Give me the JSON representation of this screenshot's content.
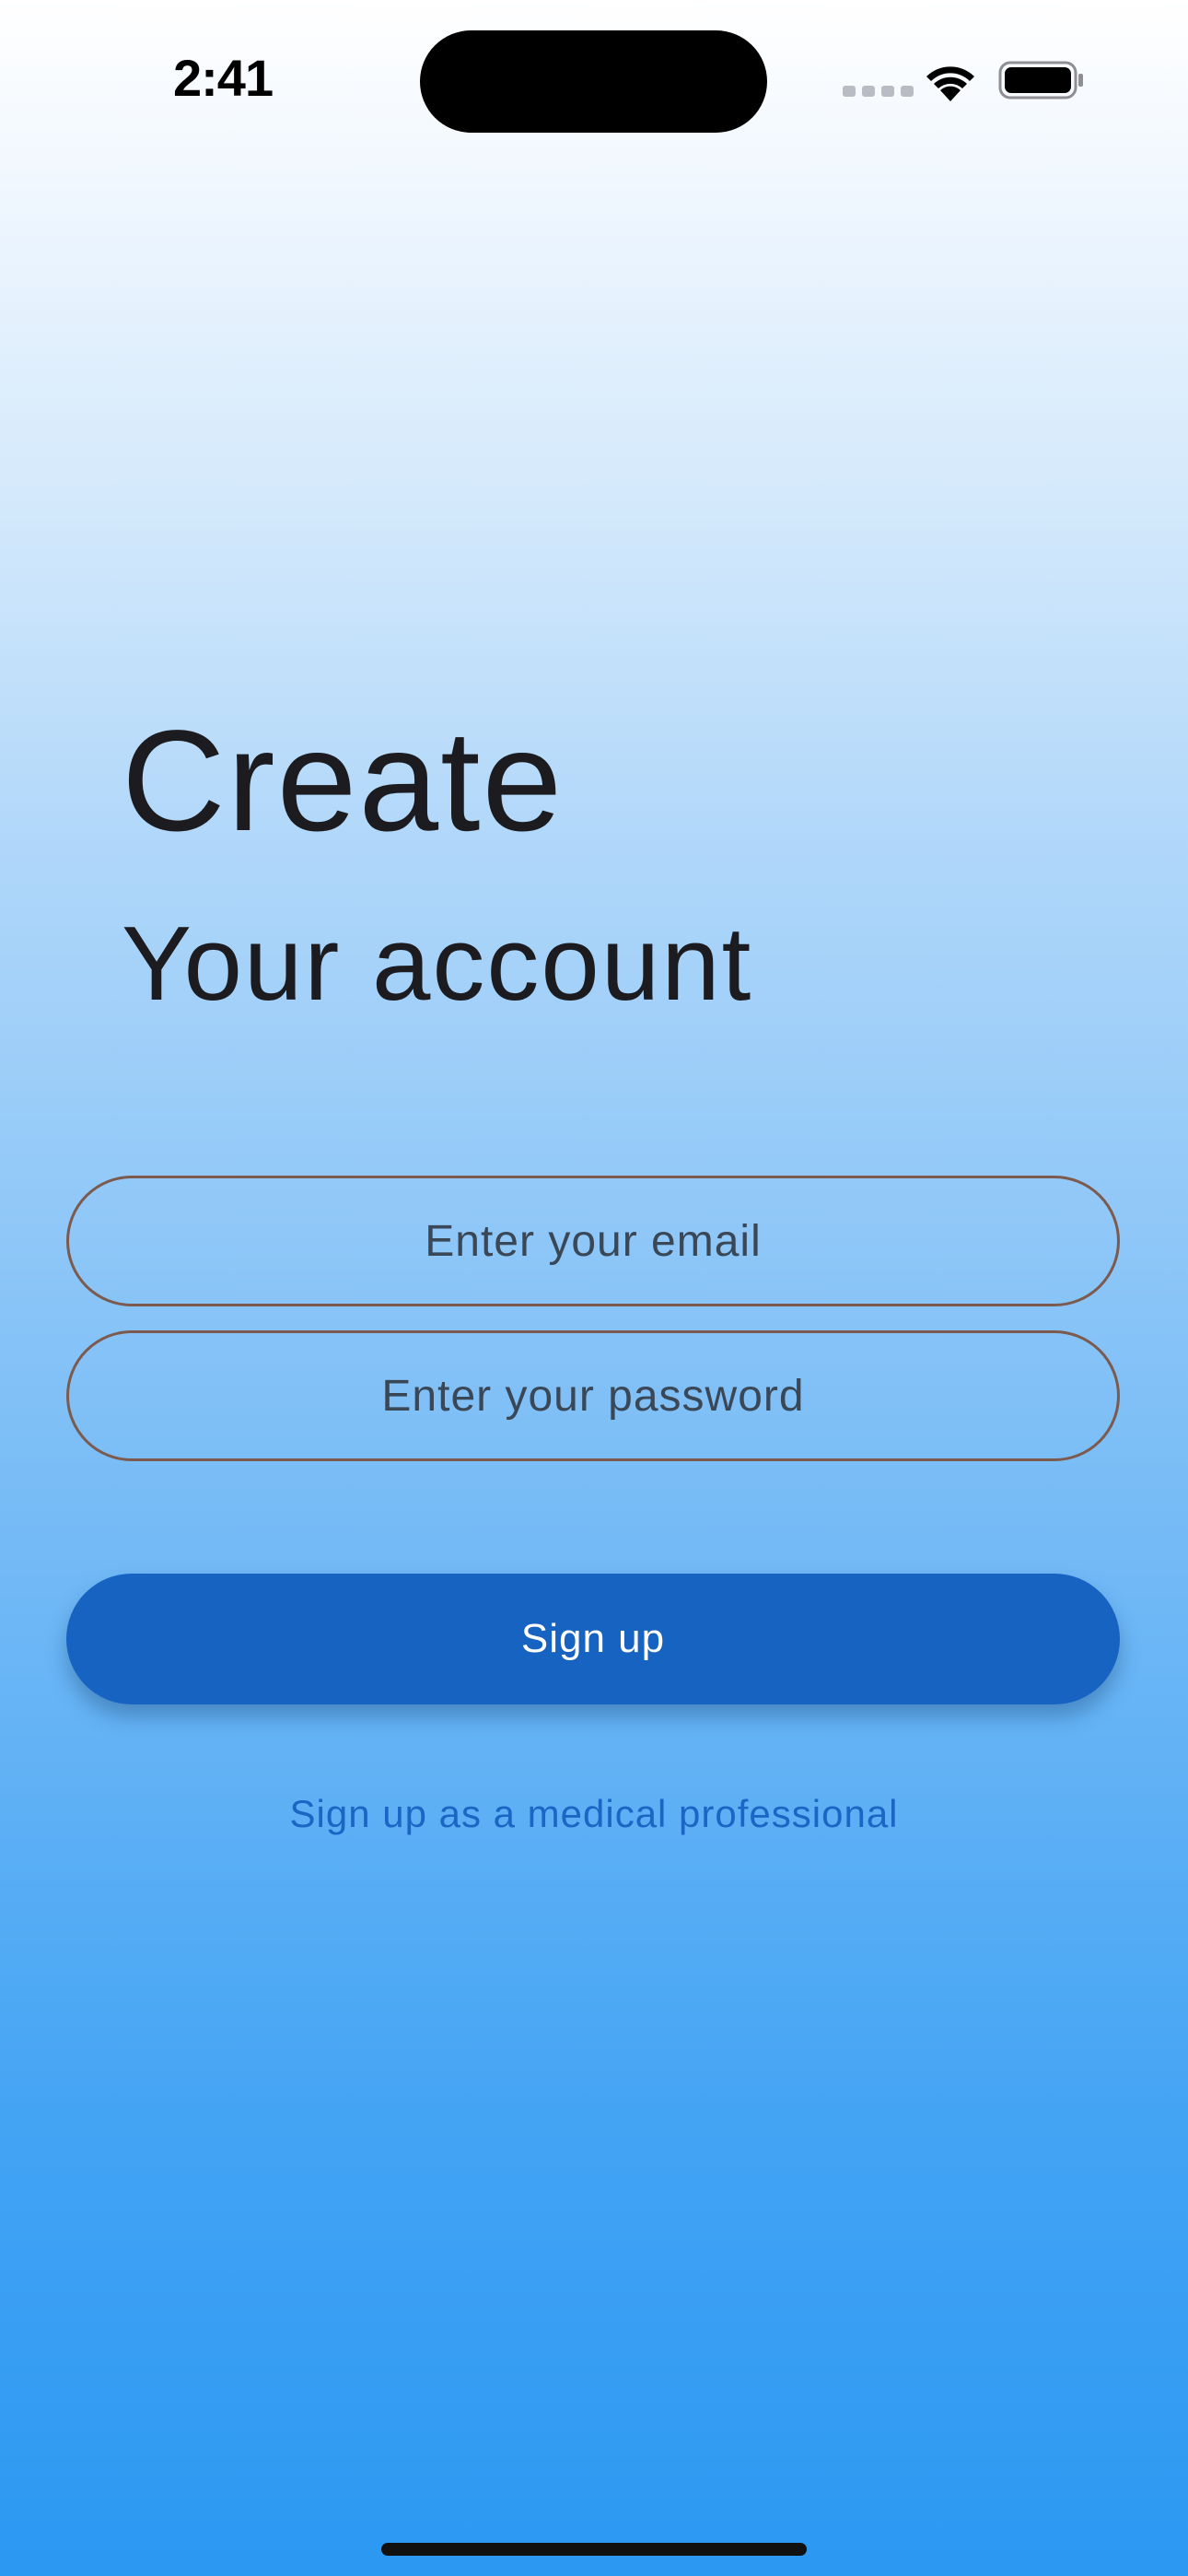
{
  "status_bar": {
    "time": "2:41",
    "wifi_icon": "wifi-icon",
    "battery_icon": "battery-icon"
  },
  "header": {
    "title": "Create",
    "subtitle": "Your account"
  },
  "form": {
    "email_placeholder": "Enter your email",
    "email_value": "",
    "password_placeholder": "Enter your password",
    "password_value": "",
    "signup_label": "Sign up",
    "professional_link": "Sign up as a medical professional"
  },
  "colors": {
    "primary": "#1663c2",
    "link": "#1a66c4",
    "field_border": "#7c5a4e",
    "gradient_top": "#ffffff",
    "gradient_bottom": "#2b98f2"
  }
}
